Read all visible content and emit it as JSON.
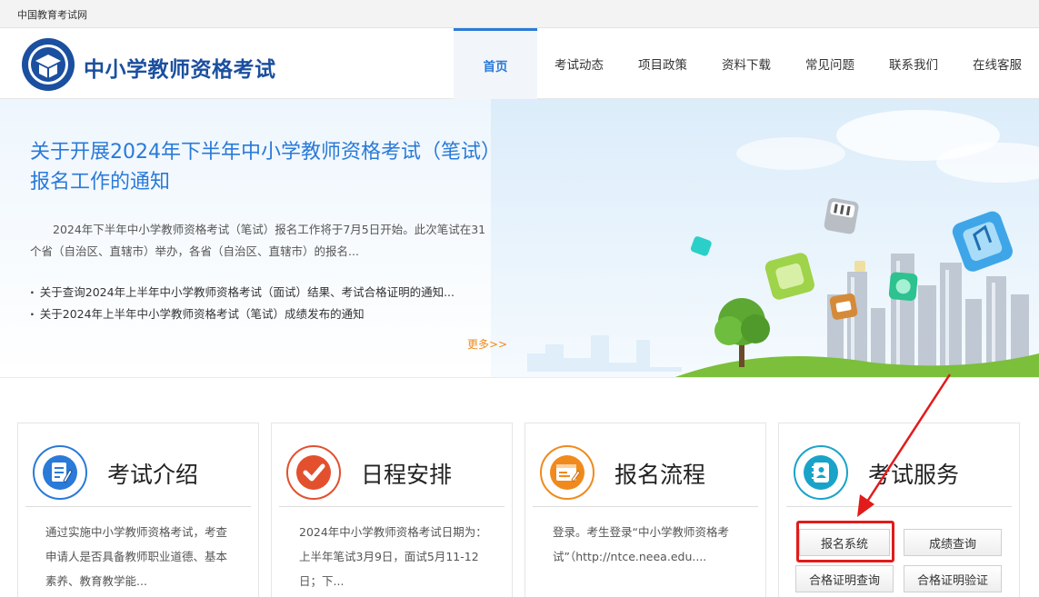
{
  "topbar": {
    "site_link": "中国教育考试网"
  },
  "header": {
    "title": "中小学教师资格考试",
    "nav": [
      "首页",
      "考试动态",
      "项目政策",
      "资料下载",
      "常见问题",
      "联系我们",
      "在线客服"
    ],
    "active_nav": "首页"
  },
  "banner": {
    "headline": "关于开展2024年下半年中小学教师资格考试（笔试）报名工作的通知",
    "summary": "2024年下半年中小学教师资格考试（笔试）报名工作将于7月5日开始。此次笔试在31个省（自治区、直辖市）举办，各省（自治区、直辖市）的报名...",
    "news": [
      "关于查询2024年上半年中小学教师资格考试（面试）结果、考试合格证明的通知...",
      "关于2024年上半年中小学教师资格考试（笔试）成绩发布的通知"
    ],
    "more": "更多>>"
  },
  "cards": [
    {
      "title": "考试介绍",
      "icon": "document-pen-icon",
      "color": "#2a7ad8",
      "body": "通过实施中小学教师资格考试，考查申请人是否具备教师职业道德、基本素养、教育教学能..."
    },
    {
      "title": "日程安排",
      "icon": "checkmark-icon",
      "color": "#e2502e",
      "body": "2024年中小学教师资格考试日期为：上半年笔试3月9日，面试5月11-12日；下..."
    },
    {
      "title": "报名流程",
      "icon": "form-edit-icon",
      "color": "#f08a1d",
      "body": "登录。考生登录“中小学教师资格考试”（http://ntce.neea.edu...."
    },
    {
      "title": "考试服务",
      "icon": "contacts-book-icon",
      "color": "#1aa3c9",
      "body": ""
    }
  ],
  "services": {
    "register": "报名系统",
    "score": "成绩查询",
    "cert_query": "合格证明查询",
    "cert_verify": "合格证明验证"
  },
  "colors": {
    "brand": "#1b4f9f",
    "link": "#2a7ad8",
    "accent_orange": "#f08a1d",
    "annotation_red": "#e21b1b"
  }
}
